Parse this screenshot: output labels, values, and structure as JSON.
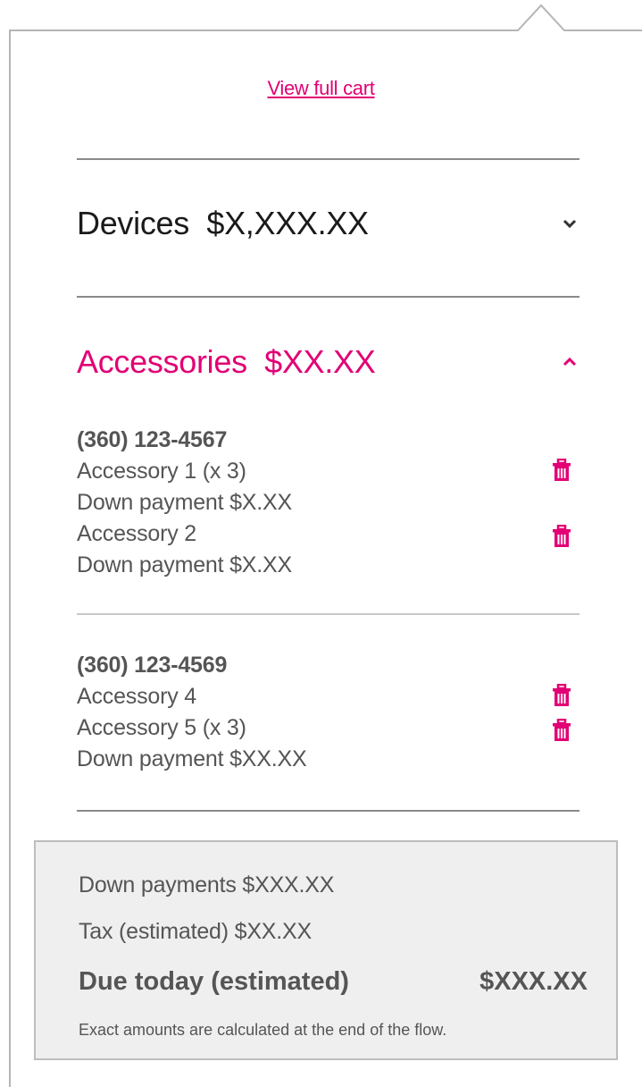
{
  "header": {
    "view_cart_link": "View full cart"
  },
  "devices": {
    "label": "Devices",
    "amount": "$X,XXX.XX",
    "icon": "chevron-down-icon"
  },
  "accessories": {
    "label": "Accessories",
    "amount": "$XX.XX",
    "icon": "chevron-up-icon",
    "lines": [
      {
        "phone": "(360) 123-4567",
        "rows": [
          "Accessory 1 (x 3)",
          "Down payment $X.XX",
          "Accessory 2",
          "Down payment $X.XX"
        ]
      },
      {
        "phone": "(360) 123-4569",
        "rows": [
          "Accessory 4",
          "Accessory 5 (x 3)",
          "Down payment $XX.XX"
        ]
      }
    ]
  },
  "summary": {
    "down_payments": "Down payments $XXX.XX",
    "tax": "Tax (estimated) $XX.XX",
    "due_label": "Due today (estimated)",
    "due_amount": "$XXX.XX",
    "note": "Exact amounts are calculated at the end of the flow."
  },
  "colors": {
    "accent": "#e20074",
    "text": "#555555",
    "panel": "#efefef"
  }
}
